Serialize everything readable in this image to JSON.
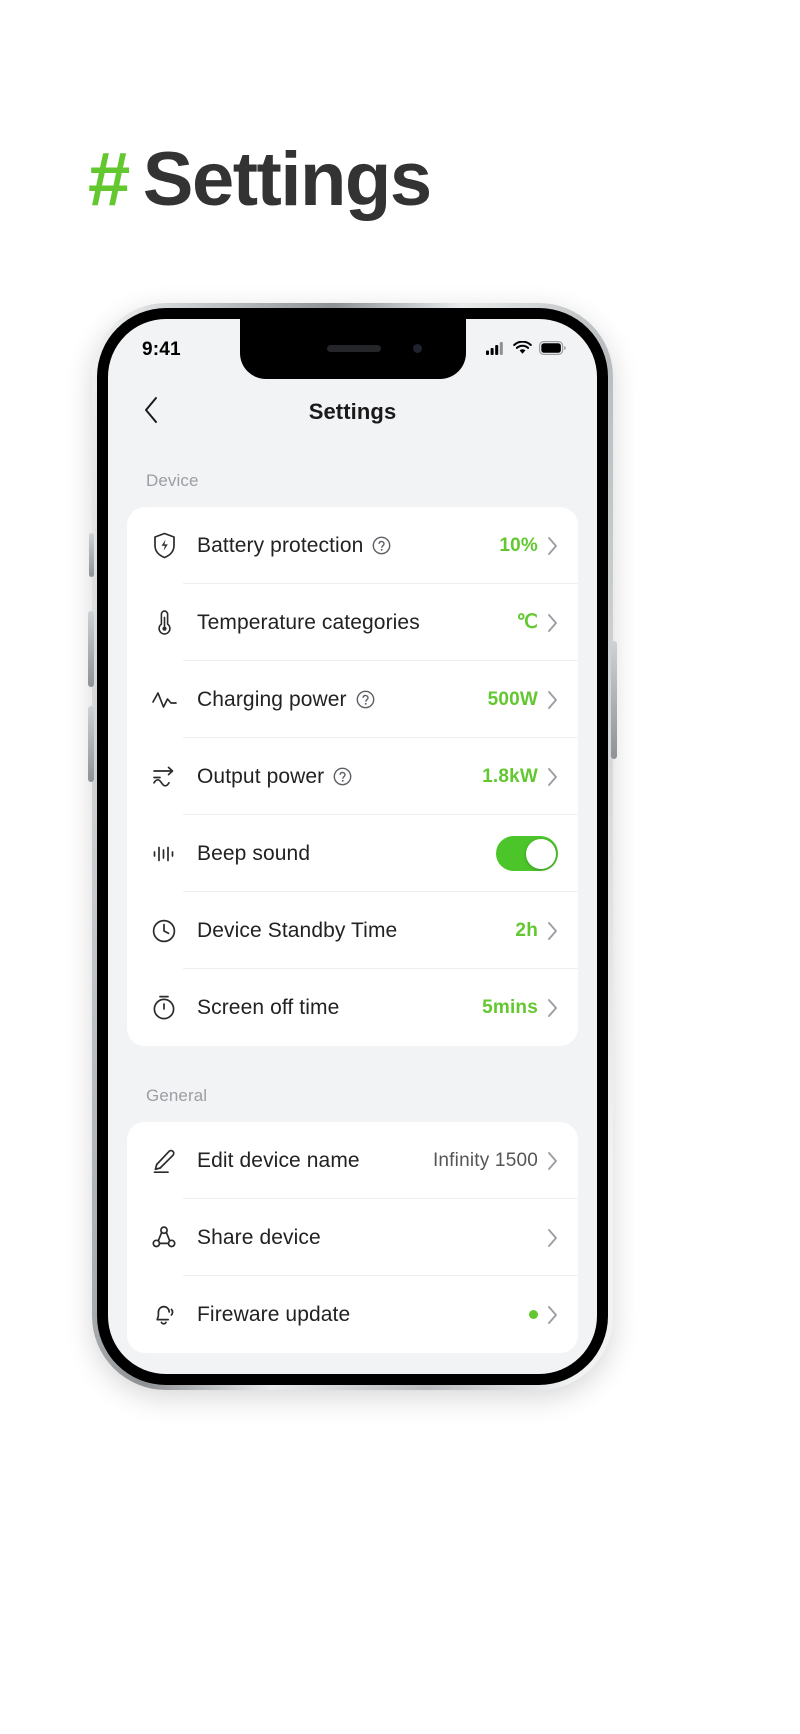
{
  "page": {
    "hash": "#",
    "title": "Settings"
  },
  "colors": {
    "accent_green": "#63C830",
    "toggle_green": "#4CC52A",
    "text_dark": "#222222",
    "text_muted": "#9b9ea3",
    "screen_bg": "#f2f3f5",
    "card_bg": "#ffffff"
  },
  "status_bar": {
    "time": "9:41",
    "icons": [
      "cellular-signal-icon",
      "wifi-icon",
      "battery-icon"
    ]
  },
  "nav": {
    "back_icon": "chevron-left-icon",
    "title": "Settings"
  },
  "sections": [
    {
      "label": "Device",
      "rows": [
        {
          "icon": "shield-bolt-icon",
          "label": "Battery protection",
          "help": true,
          "value": "10%",
          "value_style": "accent",
          "control": "chevron"
        },
        {
          "icon": "thermometer-icon",
          "label": "Temperature categories",
          "help": false,
          "value": "℃",
          "value_style": "accent",
          "control": "chevron"
        },
        {
          "icon": "pulse-icon",
          "label": "Charging power",
          "help": true,
          "value": "500W",
          "value_style": "accent",
          "control": "chevron"
        },
        {
          "icon": "ac-dc-icon",
          "label": "Output power",
          "help": true,
          "value": "1.8kW",
          "value_style": "accent",
          "control": "chevron"
        },
        {
          "icon": "waveform-icon",
          "label": "Beep sound",
          "help": false,
          "value": "",
          "value_style": "accent",
          "control": "toggle",
          "toggle_on": true
        },
        {
          "icon": "clock-icon",
          "label": "Device Standby Time",
          "help": false,
          "value": "2h",
          "value_style": "accent",
          "control": "chevron"
        },
        {
          "icon": "timer-icon",
          "label": "Screen off time",
          "help": false,
          "value": "5mins",
          "value_style": "accent",
          "control": "chevron"
        }
      ]
    },
    {
      "label": "General",
      "rows": [
        {
          "icon": "pencil-icon",
          "label": "Edit device name",
          "help": false,
          "value": "Infinity 1500",
          "value_style": "neutral",
          "control": "chevron"
        },
        {
          "icon": "share-icon",
          "label": "Share device",
          "help": false,
          "value": "",
          "value_style": "neutral",
          "control": "chevron"
        },
        {
          "icon": "bell-icon",
          "label": "Fireware update",
          "help": false,
          "value": "",
          "value_style": "neutral",
          "control": "chevron",
          "badge_dot": true
        }
      ]
    }
  ]
}
